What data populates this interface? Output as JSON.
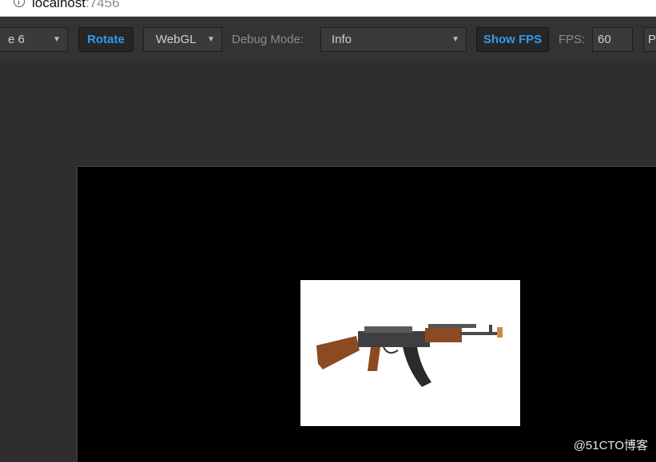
{
  "browser": {
    "url_host": "localhost",
    "url_port": ":7456"
  },
  "toolbar": {
    "device_select": "e 6",
    "rotate_label": "Rotate",
    "renderer_select": "WebGL",
    "debug_mode_label": "Debug Mode:",
    "debug_mode_select": "Info",
    "show_fps_label": "Show FPS",
    "fps_label": "FPS:",
    "fps_value": "60",
    "cut_button_label": "P"
  },
  "stage": {
    "image_subject": "rifle-image"
  },
  "watermark": "@51CTO博客",
  "colors": {
    "background": "#2e2e2e",
    "toolbar": "#333333",
    "accent": "#2f9bf0",
    "stage": "#000000"
  }
}
